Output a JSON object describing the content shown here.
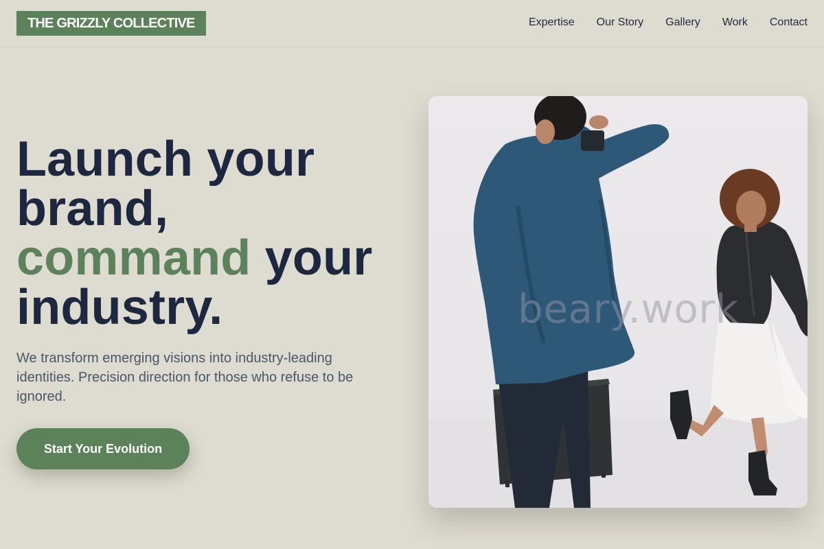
{
  "header": {
    "logo_text": "THE GRIZZLY COLLECTIVE",
    "nav": [
      {
        "label": "Expertise"
      },
      {
        "label": "Our Story"
      },
      {
        "label": "Gallery"
      },
      {
        "label": "Work"
      },
      {
        "label": "Contact"
      }
    ]
  },
  "hero": {
    "headline_line1": "Launch your brand,",
    "headline_accent": "command",
    "headline_line2_rest": " your industry.",
    "subtext": "We transform emerging visions into industry-leading identities. Precision direction for those who refuse to be ignored.",
    "cta_label": "Start Your Evolution",
    "image": {
      "subject": "photographer-shooting-model-photo",
      "watermark": "beary.work"
    }
  },
  "colors": {
    "background": "#dedbd0",
    "brand_green": "#5b8259",
    "heading": "#1c2740",
    "body_text": "#4a5669"
  }
}
